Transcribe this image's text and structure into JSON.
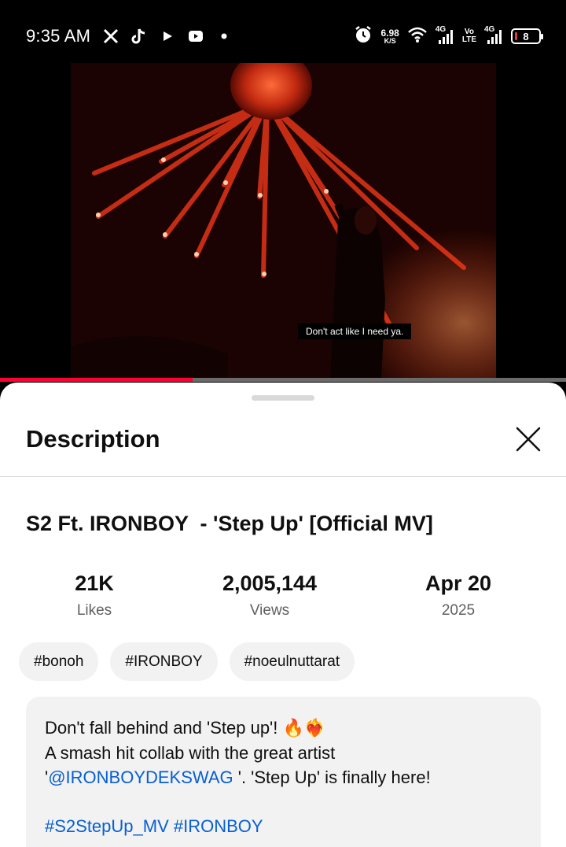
{
  "status_bar": {
    "time": "9:35 AM",
    "net_speed_value": "6.98",
    "net_speed_unit": "K/S",
    "sim1_label": "4G",
    "volte_top": "Vo",
    "volte_bottom": "LTE",
    "sim2_label": "4G",
    "battery_level": "8",
    "left_icons": [
      "x-icon",
      "tiktok-icon",
      "play-icon",
      "youtube-icon",
      "dot-icon"
    ]
  },
  "video": {
    "subtitle": "Don't act like I need ya.",
    "progress_fraction": 0.34
  },
  "sheet": {
    "title": "Description",
    "video_title": "S2 Ft. IRONBOY  - 'Step Up' [Official MV]",
    "stats": {
      "likes_value": "21K",
      "likes_label": "Likes",
      "views_value": "2,005,144",
      "views_label": "Views",
      "date_value": "Apr 20",
      "date_year": "2025"
    },
    "tags": [
      "#bonoh",
      "#IRONBOY",
      "#noeulnuttarat"
    ],
    "description": {
      "line1_text": "Don't fall behind and 'Step up'! ",
      "line1_emoji": "🔥❤️‍🔥",
      "line2": "A smash hit collab with the great artist",
      "line3_prefix": "'",
      "line3_link": "@IRONBOYDEKSWAG",
      "line3_suffix": " '. 'Step Up' is finally here!",
      "hashtag1": "#S2StepUp_MV",
      "hashtag2": "#IRONBOY"
    }
  },
  "colors": {
    "accent_red": "#ff0033",
    "link_blue": "#065fd4",
    "chip_bg": "#f2f2f2"
  }
}
